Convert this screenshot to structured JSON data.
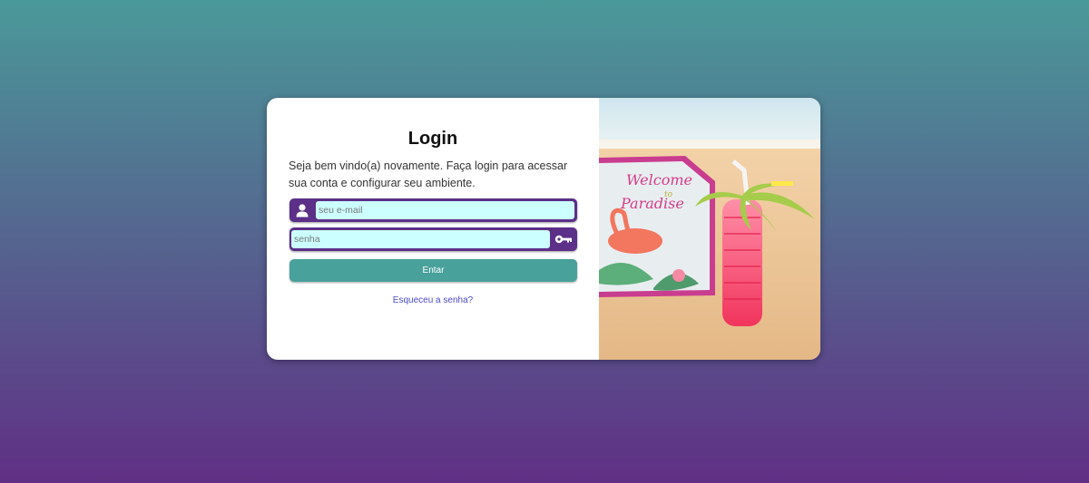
{
  "login": {
    "title": "Login",
    "subtitle": "Seja bem vindo(a) novamente. Faça login para acessar sua conta e configurar seu ambiente.",
    "email_placeholder": "seu e-mail",
    "email_icon": "user-icon",
    "password_placeholder": "senha",
    "password_icon": "key-icon",
    "submit_label": "Entar",
    "forgot_link": "Esqueceu a senha?"
  },
  "photo": {
    "sign_line1": "Welcome",
    "sign_line2": "to",
    "sign_line3": "Paradise"
  },
  "colors": {
    "accent_purple": "#5c2f88",
    "input_bg": "#ccffff",
    "button_teal": "#48a19b",
    "link_blue": "#4a4ad0"
  }
}
